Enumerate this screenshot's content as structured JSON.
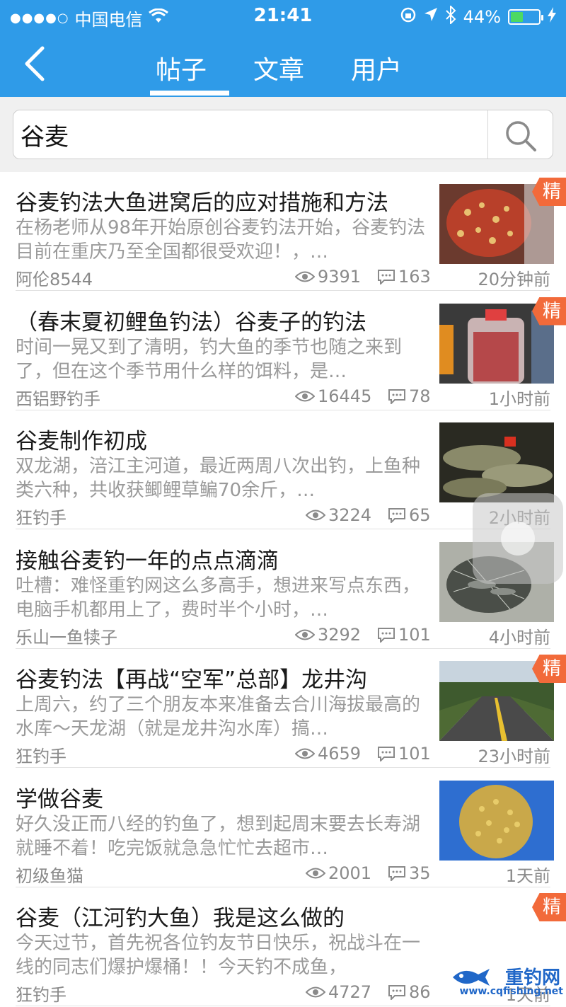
{
  "status_bar": {
    "signal": "●●●●○",
    "carrier": "中国电信",
    "time": "21:41",
    "battery_pct": "44%",
    "battery_level": 0.44
  },
  "nav": {
    "tabs": [
      {
        "label": "帖子",
        "active": true
      },
      {
        "label": "文章",
        "active": false
      },
      {
        "label": "用户",
        "active": false
      }
    ]
  },
  "search": {
    "value": "谷麦",
    "placeholder": ""
  },
  "badge_label": "精",
  "posts": [
    {
      "title": "谷麦钓法大鱼进窝后的应对措施和方法",
      "summary": "在杨老师从98年开始原创谷麦钓法开始，谷麦钓法目前在重庆乃至全国都很受欢迎！，…",
      "author": "阿伦8544",
      "views": "9391",
      "comments": "163",
      "time": "20分钟前",
      "featured": true,
      "thumb": "red-bait"
    },
    {
      "title": "（春末夏初鲤鱼钓法）谷麦子的钓法",
      "summary": "时间一晃又到了清明，钓大鱼的季节也随之来到了，但在这个季节用什么样的饵料，是…",
      "author": "西铝野钓手",
      "views": "16445",
      "comments": "78",
      "time": "1小时前",
      "featured": true,
      "thumb": "bait-bottle"
    },
    {
      "title": "谷麦制作初成",
      "summary": "双龙湖，涪江主河道，最近两周八次出钓，上鱼种类六种，共收获鲫鲤草鳊70余斤，…",
      "author": "狂钓手",
      "views": "3224",
      "comments": "65",
      "time": "2小时前",
      "featured": false,
      "thumb": "fish-catch"
    },
    {
      "title": "接触谷麦钓一年的点点滴滴",
      "summary": "吐槽：难怪重钓网这么多高手，想进来写点东西，电脑手机都用上了，费时半个小时，…",
      "author": "乐山一鱼犊子",
      "views": "3292",
      "comments": "101",
      "time": "4小时前",
      "featured": false,
      "thumb": "fish-net"
    },
    {
      "title": "谷麦钓法【再战“空军”总部】龙井沟",
      "summary": "上周六，约了三个朋友本来准备去合川海拔最高的水库～天龙湖（就是龙井沟水库）搞…",
      "author": "狂钓手",
      "views": "4659",
      "comments": "101",
      "time": "23小时前",
      "featured": true,
      "thumb": "road"
    },
    {
      "title": "学做谷麦",
      "summary": "好久没正而八经的钓鱼了，想到起周末要去长寿湖就睡不着！吃完饭就急急忙忙去超市…",
      "author": "初级鱼猫",
      "views": "2001",
      "comments": "35",
      "time": "1天前",
      "featured": false,
      "thumb": "corn-bowl"
    },
    {
      "title": "谷麦（江河钓大鱼）我是这么做的",
      "summary": "今天过节，首先祝各位钓友节日快乐，祝战斗在一线的同志们爆护爆桶！！今天钓不成鱼，",
      "author": "狂钓手",
      "views": "4727",
      "comments": "86",
      "time": "1天前",
      "featured": true,
      "thumb": ""
    }
  ],
  "watermark": {
    "title": "重钓网",
    "url": "www.cqfishing.net"
  },
  "colors": {
    "header": "#2f9be8",
    "badge": "#f26a3a",
    "meta": "#8a8a8a"
  }
}
